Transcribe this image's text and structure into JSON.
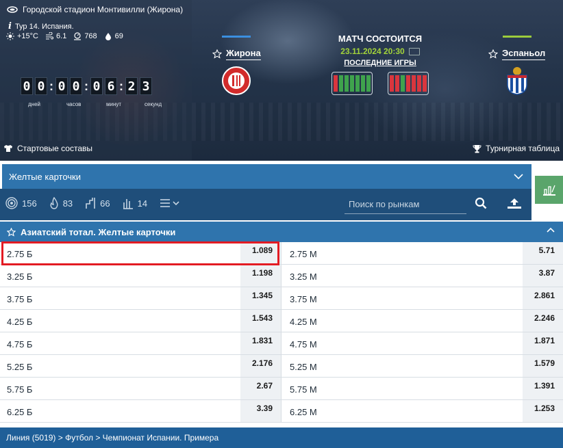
{
  "header": {
    "venue": "Городской стадион Монтивилли (Жирона)",
    "tour": "Тур 14. Испания.",
    "weather": {
      "temperature": "+15°C",
      "wind": "6.1",
      "pressure": "768",
      "humidity": "69"
    },
    "countdown": {
      "digits": [
        "0",
        "0",
        "0",
        "0",
        "0",
        "6",
        "2",
        "3"
      ],
      "labels": [
        "дней",
        "часов",
        "минут",
        "секунд"
      ]
    },
    "lineups_label": "Стартовые составы",
    "standings_label": "Турнирная таблица"
  },
  "match": {
    "home": {
      "name": "Жирона",
      "bar_color": "#3b8fe0"
    },
    "away": {
      "name": "Эспаньол",
      "bar_color": "#9ccc3c"
    },
    "status": "МАТЧ СОСТОИТСЯ",
    "datetime": "23.11.2024 20:30",
    "last_games_label": "ПОСЛЕДНИЕ ИГРЫ",
    "home_form": [
      "red",
      "green",
      "green",
      "green",
      "green",
      "green",
      "green"
    ],
    "away_form": [
      "red",
      "red",
      "green",
      "red",
      "red",
      "red",
      "red"
    ]
  },
  "market": {
    "selected": "Желтые карточки",
    "counts": [
      {
        "icon": "target-icon",
        "value": "156"
      },
      {
        "icon": "fire-icon",
        "value": "83"
      },
      {
        "icon": "ladder-icon",
        "value": "66"
      },
      {
        "icon": "bars-icon",
        "value": "14"
      }
    ],
    "search_placeholder": "Поиск по рынкам"
  },
  "section": {
    "title": "Азиатский тотал. Желтые карточки",
    "rows": [
      {
        "left": "2.75 Б",
        "left_odds": "1.089",
        "right": "2.75 М",
        "right_odds": "5.71"
      },
      {
        "left": "3.25 Б",
        "left_odds": "1.198",
        "right": "3.25 М",
        "right_odds": "3.87"
      },
      {
        "left": "3.75 Б",
        "left_odds": "1.345",
        "right": "3.75 М",
        "right_odds": "2.861"
      },
      {
        "left": "4.25 Б",
        "left_odds": "1.543",
        "right": "4.25 М",
        "right_odds": "2.246"
      },
      {
        "left": "4.75 Б",
        "left_odds": "1.831",
        "right": "4.75 М",
        "right_odds": "1.871"
      },
      {
        "left": "5.25 Б",
        "left_odds": "2.176",
        "right": "5.25 М",
        "right_odds": "1.579"
      },
      {
        "left": "5.75 Б",
        "left_odds": "2.67",
        "right": "5.75 М",
        "right_odds": "1.391"
      },
      {
        "left": "6.25 Б",
        "left_odds": "3.39",
        "right": "6.25 М",
        "right_odds": "1.253"
      }
    ]
  },
  "breadcrumb": "Линия (5019) > Футбол > Чемпионат Испании. Примера",
  "colors": {
    "accent_blue": "#2f74ad",
    "dark_blue": "#1f4e7a",
    "highlight_red": "#e31b23",
    "green": "#5aa56b"
  }
}
